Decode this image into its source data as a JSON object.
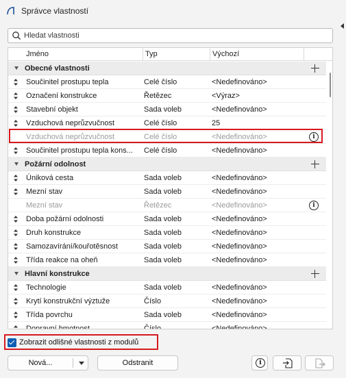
{
  "window": {
    "title": "Správce vlastností"
  },
  "search": {
    "placeholder": "Hledat vlastnosti"
  },
  "table": {
    "headers": {
      "name": "Jméno",
      "type": "Typ",
      "default": "Výchozí"
    }
  },
  "groups": [
    {
      "title": "Obecné vlastnosti"
    },
    {
      "title": "Požární odolnost"
    },
    {
      "title": "Hlavní konstrukce"
    }
  ],
  "rows": [
    {
      "name": "Součinitel prostupu tepla",
      "type": "Celé číslo",
      "default": "<Nedefinováno>"
    },
    {
      "name": "Označení konstrukce",
      "type": "Řetězec",
      "default": "<Výraz>"
    },
    {
      "name": "Stavební objekt",
      "type": "Sada voleb",
      "default": "<Nedefinováno>"
    },
    {
      "name": "Vzduchová neprůzvučnost",
      "type": "Celé číslo",
      "default": "25"
    },
    {
      "name": "Vzduchová neprůzvučnost",
      "type": "Celé číslo",
      "default": "<Nedefinováno>"
    },
    {
      "name": "Součinitel prostupu tepla kons...",
      "type": "Celé číslo",
      "default": "<Nedefinováno>"
    },
    {
      "name": "Úniková cesta",
      "type": "Sada voleb",
      "default": "<Nedefinováno>"
    },
    {
      "name": "Mezní stav",
      "type": "Sada voleb",
      "default": "<Nedefinováno>"
    },
    {
      "name": "Mezní stav",
      "type": "Řetězec",
      "default": "<Nedefinováno>"
    },
    {
      "name": "Doba požární odolnosti",
      "type": "Sada voleb",
      "default": "<Nedefinováno>"
    },
    {
      "name": "Druh konstrukce",
      "type": "Sada voleb",
      "default": "<Nedefinováno>"
    },
    {
      "name": "Samozavírání/kouřotěsnost",
      "type": "Sada voleb",
      "default": "<Nedefinováno>"
    },
    {
      "name": "Třída reakce na oheň",
      "type": "Sada voleb",
      "default": "<Nedefinováno>"
    },
    {
      "name": "Technologie",
      "type": "Sada voleb",
      "default": "<Nedefinováno>"
    },
    {
      "name": "Krytí konstrukční výztuže",
      "type": "Číslo",
      "default": "<Nedefinováno>"
    },
    {
      "name": "Třída povrchu",
      "type": "Sada voleb",
      "default": "<Nedefinováno>"
    },
    {
      "name": "Dopravní hmotnost",
      "type": "Číslo",
      "default": "<Nedefinováno>"
    }
  ],
  "options": {
    "show_different_label": "Zobrazit odlišné vlastnosti z modulů",
    "show_different_checked": true
  },
  "buttons": {
    "new_label": "Nová...",
    "delete_label": "Odstranit"
  },
  "icons": {
    "info": "i"
  },
  "colors": {
    "highlight": "#d6191f",
    "checkbox": "#0b5fb3",
    "muted_text": "#9a9a9a"
  }
}
